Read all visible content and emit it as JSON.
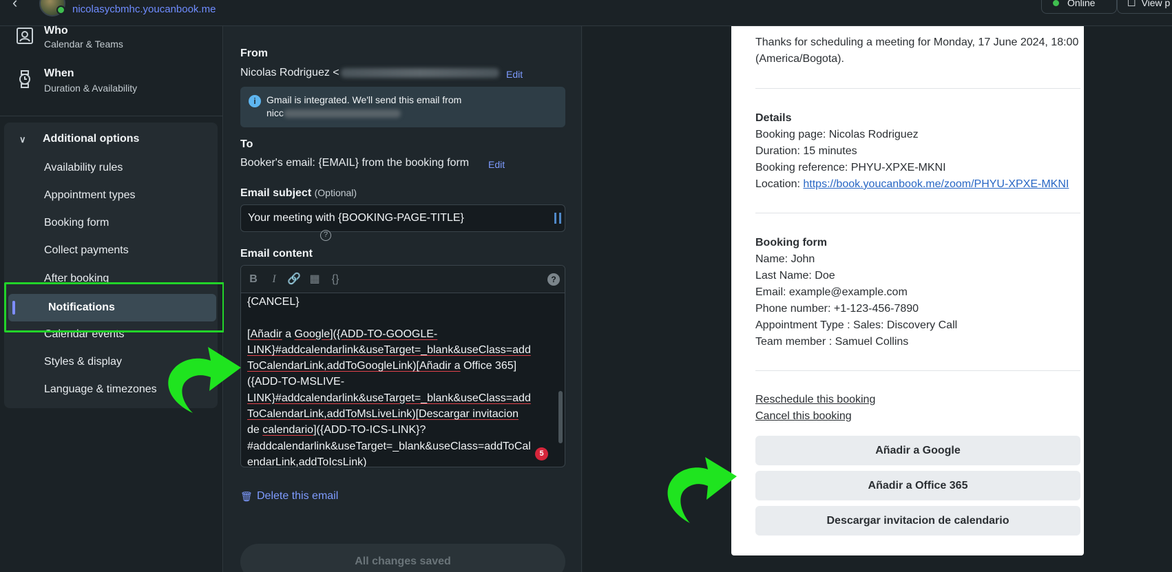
{
  "topbar": {
    "domain": "nicolasycbmhc.youcanbook.me",
    "status": "Online",
    "view_label": "View p"
  },
  "sidebar": {
    "who": {
      "title": "Who",
      "subtitle": "Calendar & Teams"
    },
    "when": {
      "title": "When",
      "subtitle": "Duration & Availability"
    },
    "additional_options": "Additional options",
    "items": [
      "Availability rules",
      "Appointment types",
      "Booking form",
      "Collect payments",
      "After booking",
      "Notifications",
      "Calendar events",
      "Styles & display",
      "Language & timezones"
    ],
    "active_item": "Notifications"
  },
  "editor": {
    "from_label": "From",
    "from_value": "Nicolas Rodriguez <",
    "edit_label": "Edit",
    "info_text_1": "Gmail is integrated. We'll send this email from",
    "info_text_2": "nicc",
    "to_label": "To",
    "to_value": "Booker's email: {EMAIL} from the booking form",
    "subject_label": "Email subject",
    "subject_optional": "(Optional)",
    "subject_value": "Your meeting with {BOOKING-PAGE-TITLE}",
    "content_label": "Email content",
    "content_lines": {
      "l1": "{CANCEL}",
      "l2a": "[",
      "l2b": "Añadir",
      "l2c": " a ",
      "l2d": "Google",
      "l2e": "]({ADD-TO-GOOGLE-",
      "l3": "LINK}#addcalendarlink&useTarget=_blank&useClass=add",
      "l4a": "ToCalendarLink,addToGoogleLink)[Añadir a",
      "l4b": " Office 365]",
      "l5": "({ADD-TO-MSLIVE-",
      "l6": "LINK}#addcalendarlink&useTarget=_blank&useClass=add",
      "l7a": "ToCalendarLink,addToMsLiveLink)[Descargar ",
      "l7b": "invitacion",
      "l8a": "de ",
      "l8b": "calendario",
      "l8c": "]({ADD-TO-ICS-LINK}?",
      "l9": "#addcalendarlink&useTarget=_blank&useClass=addToCal",
      "l10": "endarLink,addToIcsLink)"
    },
    "error_count": "5",
    "delete_label": "Delete this email",
    "saved_label": "All changes saved"
  },
  "preview": {
    "thanks": "Thanks for scheduling a meeting for Monday, 17 June 2024, 18:00 (America/Bogota).",
    "details_title": "Details",
    "booking_page": "Booking page: Nicolas Rodriguez",
    "duration": "Duration: 15 minutes",
    "reference": "Booking reference: PHYU-XPXE-MKNI",
    "location_label": "Location: ",
    "location_url": "https://book.youcanbook.me/zoom/PHYU-XPXE-MKNI",
    "form_title": "Booking form",
    "name": "Name: John",
    "last_name": "Last Name: Doe",
    "email": "Email: example@example.com",
    "phone": "Phone number: +1-123-456-7890",
    "appt_type": "Appointment Type : Sales: Discovery Call",
    "team_member": "Team member : Samuel Collins",
    "reschedule": "Reschedule this booking",
    "cancel": "Cancel this booking",
    "btn_google": "Añadir a Google",
    "btn_office": "Añadir a Office 365",
    "btn_ics": "Descargar invitacion de calendario"
  },
  "colors": {
    "accent": "#7e9bff",
    "highlight": "#22d329",
    "error": "#d6263b",
    "link": "#2766c4"
  }
}
